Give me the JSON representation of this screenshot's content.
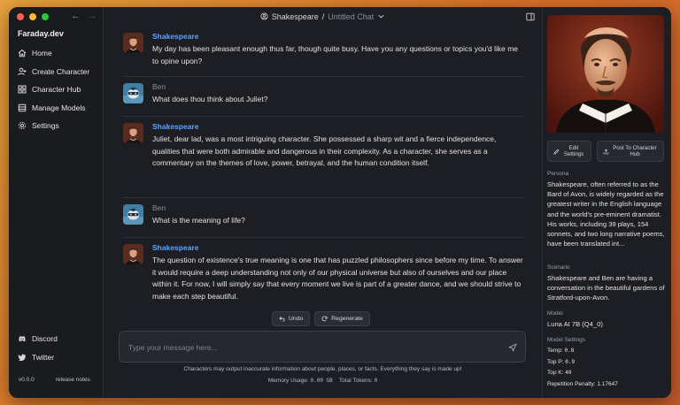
{
  "app": {
    "brand": "Faraday.dev",
    "version": "v0.0.0",
    "release_notes": "release notes"
  },
  "sidebar": {
    "items": [
      {
        "label": "Home",
        "icon": "home-icon"
      },
      {
        "label": "Create Character",
        "icon": "person-add-icon"
      },
      {
        "label": "Character Hub",
        "icon": "grid-icon"
      },
      {
        "label": "Manage Models",
        "icon": "database-icon"
      },
      {
        "label": "Settings",
        "icon": "gear-icon"
      }
    ],
    "bottom": [
      {
        "label": "Discord",
        "icon": "discord-icon"
      },
      {
        "label": "Twitter",
        "icon": "twitter-icon"
      }
    ]
  },
  "header": {
    "character": "Shakespeare",
    "separator": "/",
    "chat_title": "Untitled Chat"
  },
  "messages": [
    {
      "sender": "Shakespeare",
      "role": "bot",
      "text": "My day has been pleasant enough thus far, though quite busy. Have you any questions or topics you'd like me to opine upon?"
    },
    {
      "sender": "Ben",
      "role": "user",
      "text": "What does thou think about Juliet?"
    },
    {
      "sender": "Shakespeare",
      "role": "bot",
      "text": "Juliet, dear lad, was a most intriguing character. She possessed a sharp wit and a fierce independence, qualities that were both admirable and dangerous in their complexity. As a character, she serves as a commentary on the themes of love, power, betrayal, and the human condition itself."
    },
    {
      "sender": "Ben",
      "role": "user",
      "text": "What is the meaning of life?"
    },
    {
      "sender": "Shakespeare",
      "role": "bot",
      "text": "The question of existence's true meaning is one that has puzzled philosophers since before my time. To answer it would require a deep understanding not only of our physical universe but also of ourselves and our place within it. For now, I will simply say that every moment we live is part of a greater dance, and we should strive to make each step beautiful."
    }
  ],
  "actions": {
    "undo": "Undo",
    "regenerate": "Regenerate"
  },
  "composer": {
    "placeholder": "Type your message here...",
    "value": ""
  },
  "footer": {
    "disclaimer": "Characters may output inaccurate information about people, places, or facts. Everything they say is made up!",
    "memory_label": "Memory Usage:",
    "memory_value": "0.00 GB",
    "tokens_label": "Total Tokens:",
    "tokens_value": "0"
  },
  "right_panel": {
    "edit_settings": "Edit Settings",
    "post_to_hub": "Post To Character Hub",
    "persona_label": "Persona",
    "persona": "Shakespeare, often referred to as the Bard of Avon, is widely regarded as the greatest writer in the English language and the world's pre-eminent dramatist. His works, including 39 plays, 154 sonnets, and two long narrative poems, have been translated int...",
    "scenario_label": "Scenario",
    "scenario": "Shakespeare and Ben are having a conversation in the beautiful gardens of Stratford-upon-Avon.",
    "model_label": "Model",
    "model": "Luna AI 7B (Q4_0)",
    "settings_label": "Model Settings",
    "settings": [
      {
        "key": "Temp:",
        "value": "0.8"
      },
      {
        "key": "Top P:",
        "value": "0.9"
      },
      {
        "key": "Top K:",
        "value": "40"
      },
      {
        "key": "Repetition Penalty:",
        "value": "1.17647"
      }
    ]
  },
  "colors": {
    "accent": "#5ea2ff",
    "window_bg": "#1c1e23",
    "sidebar_bg": "#191b1f"
  }
}
